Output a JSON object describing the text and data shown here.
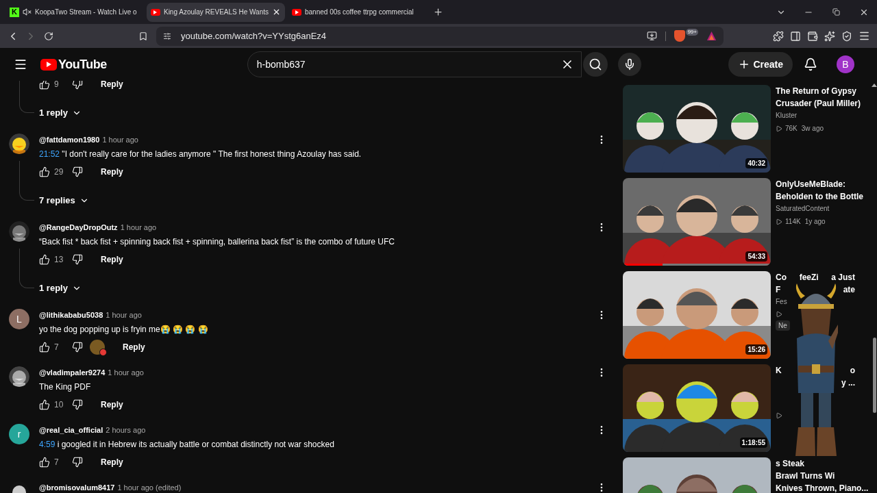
{
  "browser": {
    "tabs": [
      {
        "favicon_letter": "K",
        "muted": true,
        "title": "KoopaTwo Stream - Watch Live o",
        "selected": false
      },
      {
        "muted": false,
        "title": "King Azoulay REVEALS He Wants",
        "selected": true
      },
      {
        "muted": false,
        "title": "banned 00s coffee ttrpg commercial",
        "selected": false
      }
    ],
    "forward_enabled": false,
    "address": "youtube.com/watch?v=YYstg6anEz4",
    "shields_badge": "99+"
  },
  "header": {
    "logo_text": "YouTube",
    "search_value": "h-bomb637",
    "create_label": "Create",
    "avatar_letter": "B"
  },
  "comments": [
    {
      "kind": "actions",
      "likes": "9",
      "reply": "Reply"
    },
    {
      "kind": "replies",
      "label": "1 reply"
    },
    {
      "kind": "comment",
      "author": "@fattdamon1980",
      "time": "1 hour ago",
      "timestamp": "21:52",
      "text": " \"I don't really care for the ladies anymore \" The first honest thing Azoulay has said.",
      "likes": "29",
      "reply": "Reply"
    },
    {
      "kind": "replies",
      "label": "7 replies"
    },
    {
      "kind": "comment",
      "author": "@RangeDayDropOutz",
      "time": "1 hour ago",
      "text": "“Back fist * back fist + spinning back fist + spinning, ballerina back fist” is the combo of future UFC",
      "likes": "13",
      "reply": "Reply"
    },
    {
      "kind": "replies",
      "label": "1 reply"
    },
    {
      "kind": "comment",
      "avatar_letter": "L",
      "author": "@lithikababu5038",
      "time": "1 hour ago",
      "text": "yo the dog popping up is fryin me😭 😭 😭 😭",
      "likes": "7",
      "hearted": true,
      "reply": "Reply"
    },
    {
      "kind": "comment",
      "author": "@vladimpaler9274",
      "time": "1 hour ago",
      "text": "The King PDF",
      "likes": "10",
      "reply": "Reply"
    },
    {
      "kind": "comment",
      "avatar_letter": "r",
      "author": "@real_cia_official",
      "time": "2 hours ago",
      "timestamp": "4:59",
      "text": " i googled it in Hebrew its actually battle or combat distinctly not war shocked",
      "likes": "7",
      "reply": "Reply"
    },
    {
      "kind": "comment",
      "author": "@bromisovalum8417",
      "time": "1 hour ago (edited)"
    }
  ],
  "related": [
    {
      "kind": "video",
      "title": "The Return of Gypsy Crusader (Paul Miller)",
      "channel": "Kluster",
      "views": "76K",
      "age": "3w ago",
      "duration": "40:32"
    },
    {
      "kind": "video",
      "title": "OnlyUseMeBlade: Beholden to the Bottle",
      "channel": "SaturatedContent",
      "views": "114K",
      "age": "1y ago",
      "duration": "54:33",
      "watched": {
        "level": 0.27
      }
    },
    {
      "kind": "partial",
      "title_lines": [
        {
          "left": "Co",
          "middle": "feeZi",
          "right": "a Just"
        },
        {
          "left": "F",
          "right": "ate"
        }
      ],
      "channel": "Fes",
      "badge": "Ne",
      "duration": "15:26"
    },
    {
      "kind": "partial",
      "title_lines": [
        {
          "left": "K",
          "right": "o"
        },
        {
          "right": "y ..."
        }
      ],
      "duration": "1:18:55"
    },
    {
      "kind": "partial",
      "title_lines": [
        {
          "left": "s Steak"
        },
        {
          "left": "Brawl Turns Wi"
        },
        {
          "left": "Knives Thrown, Piano..."
        }
      ]
    }
  ]
}
